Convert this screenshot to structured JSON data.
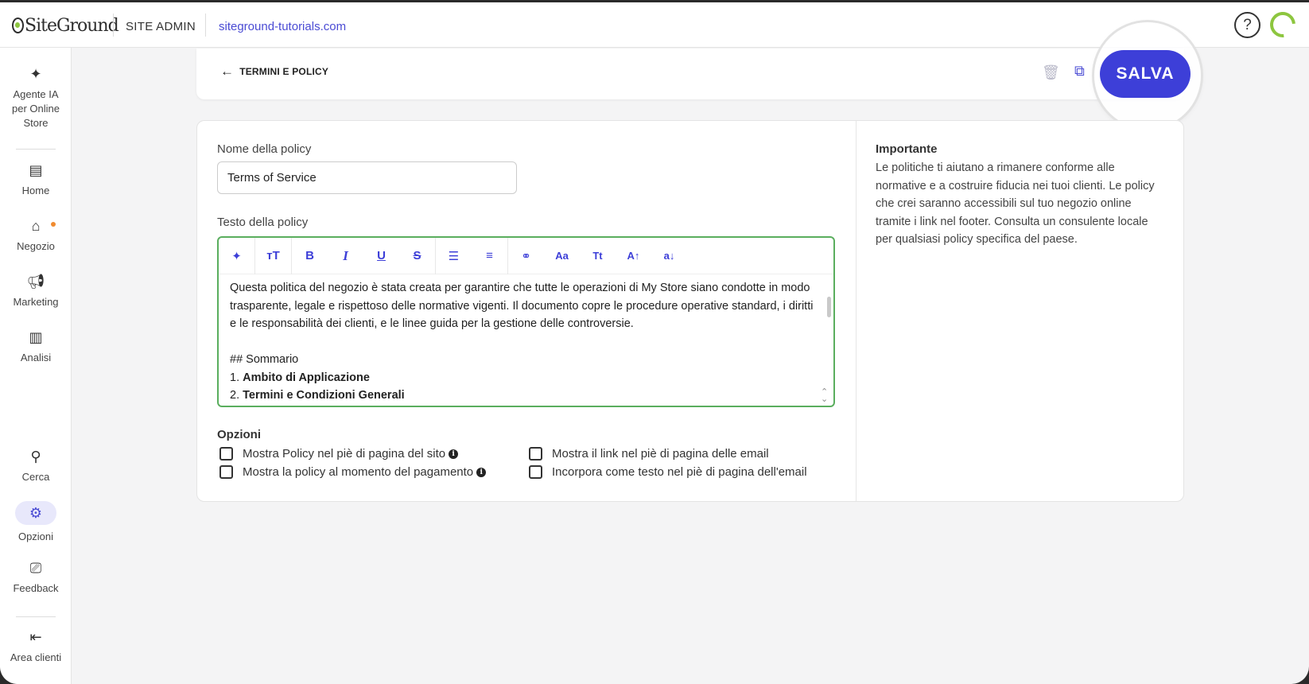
{
  "header": {
    "logo_text": "SiteGround",
    "section": "SITE ADMIN",
    "domain": "siteground-tutorials.com",
    "help_glyph": "?"
  },
  "sidebar": {
    "items": [
      {
        "label": "Agente IA per Online Store",
        "icon": "sparkle-icon"
      },
      {
        "label": "Home",
        "icon": "dashboard-icon"
      },
      {
        "label": "Negozio",
        "icon": "store-icon",
        "badge_color": "#f08b30"
      },
      {
        "label": "Marketing",
        "icon": "megaphone-icon"
      },
      {
        "label": "Analisi",
        "icon": "chart-icon"
      },
      {
        "label": "Cerca",
        "icon": "search-icon"
      },
      {
        "label": "Opzioni",
        "icon": "gear-icon",
        "active": true
      },
      {
        "label": "Feedback",
        "icon": "feedback-icon"
      },
      {
        "label": "Area clienti",
        "icon": "logout-icon"
      }
    ]
  },
  "page": {
    "back_label": "TERMINI E POLICY",
    "save_label": "SALVA",
    "accent_color": "#3d3fd8"
  },
  "form": {
    "name_label": "Nome della policy",
    "name_value": "Terms of Service",
    "text_label": "Testo della policy",
    "toolbar": [
      "sparkle-icon",
      "text-size-icon",
      "bold-icon",
      "italic-icon",
      "underline-icon",
      "strikethrough-icon",
      "bullet-list-icon",
      "numbered-list-icon",
      "link-icon",
      "font-case-icon",
      "title-case-icon",
      "uppercase-icon",
      "lowercase-icon"
    ],
    "toolbar_glyphs": {
      "bold": "B",
      "italic": "I",
      "underline": "U",
      "strike": "S",
      "case": "Aa",
      "title": "Tt",
      "upper": "A↑",
      "lower": "a↓"
    },
    "content": {
      "paragraph": "Questa politica del negozio è stata creata per garantire che tutte le operazioni di My Store siano condotte in modo trasparente, legale e rispettoso delle normative vigenti. Il documento copre le procedure operative standard, i diritti e le responsabilità dei clienti, e le linee guida per la gestione delle controversie.",
      "heading": "## Sommario",
      "item1_num": "1.",
      "item1": "Ambito di Applicazione",
      "item2_num": "2.",
      "item2": "Termini e Condizioni Generali"
    },
    "options_title": "Opzioni",
    "options": [
      "Mostra Policy nel piè di pagina del sito",
      "Mostra la policy al momento del pagamento",
      "Mostra il link nel piè di pagina delle email",
      "Incorpora come testo nel piè di pagina dell'email"
    ]
  },
  "info": {
    "title": "Importante",
    "text": "Le politiche ti aiutano a rimanere conforme alle normative e a costruire fiducia nei tuoi clienti. Le policy che crei saranno accessibili sul tuo negozio online tramite i link nel footer. Consulta un consulente locale per qualsiasi policy specifica del paese."
  }
}
